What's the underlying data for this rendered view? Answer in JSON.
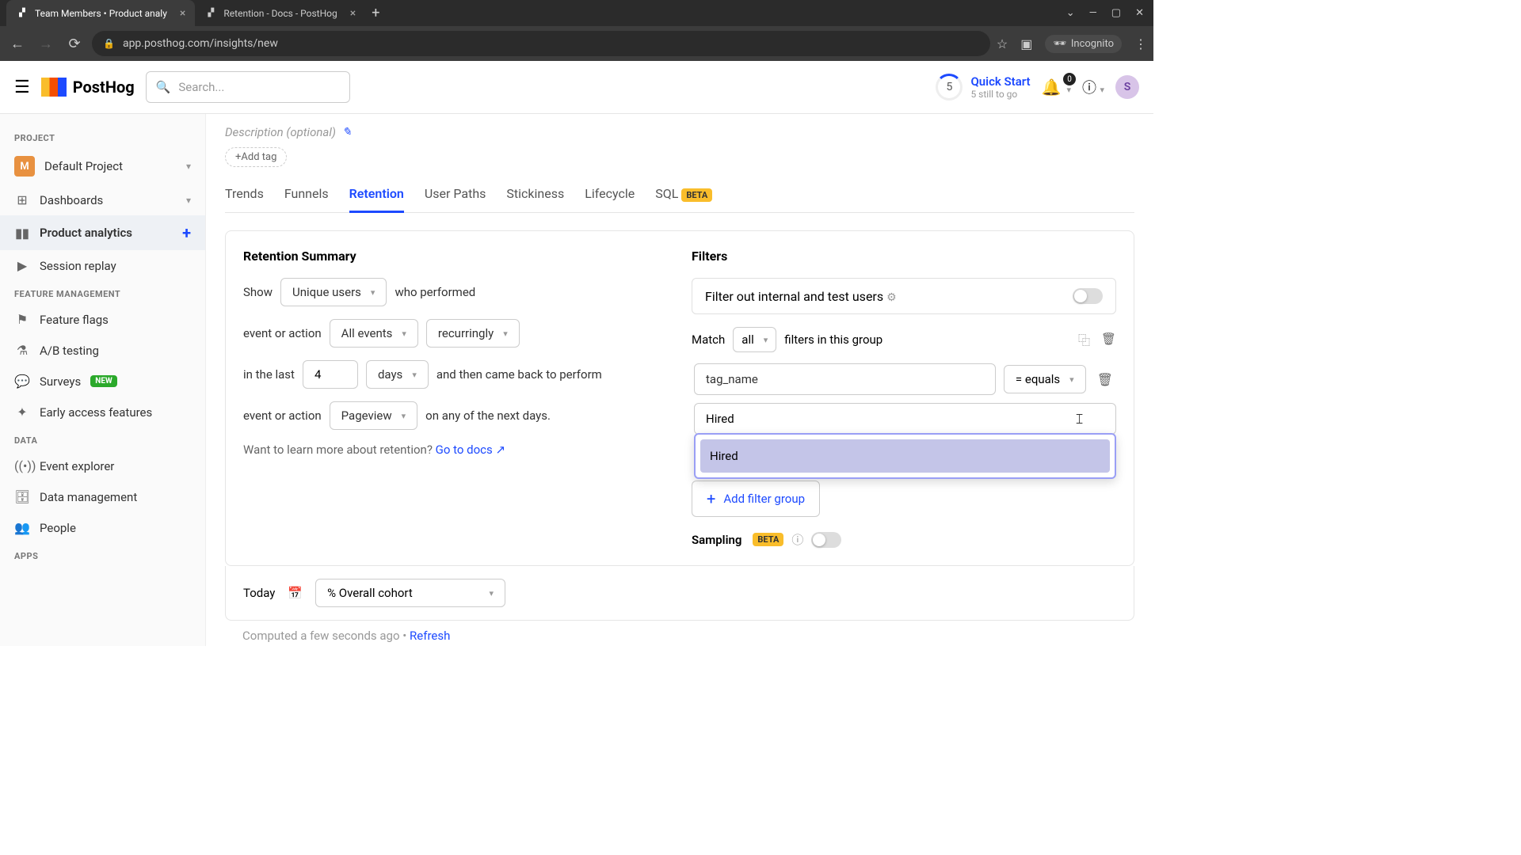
{
  "browser": {
    "tabs": [
      {
        "title": "Team Members • Product analy",
        "active": true
      },
      {
        "title": "Retention - Docs - PostHog",
        "active": false
      }
    ],
    "url": "app.posthog.com/insights/new",
    "incognito": "Incognito"
  },
  "header": {
    "logo": "PostHog",
    "search_placeholder": "Search...",
    "quick_start": {
      "count": "5",
      "title": "Quick Start",
      "sub": "5 still to go"
    },
    "bell_count": "0",
    "avatar_letter": "S"
  },
  "sidebar": {
    "sections": {
      "project": "PROJECT",
      "feature_mgmt": "FEATURE MANAGEMENT",
      "data": "DATA",
      "apps": "APPS"
    },
    "project": {
      "avatar": "M",
      "name": "Default Project"
    },
    "items": {
      "dashboards": "Dashboards",
      "product_analytics": "Product analytics",
      "session_replay": "Session replay",
      "feature_flags": "Feature flags",
      "ab_testing": "A/B testing",
      "surveys": "Surveys",
      "early_access": "Early access features",
      "event_explorer": "Event explorer",
      "data_mgmt": "Data management",
      "people": "People"
    },
    "new_badge": "NEW"
  },
  "main": {
    "description_placeholder": "Description (optional)",
    "add_tag": "Add tag",
    "tabs": [
      "Trends",
      "Funnels",
      "Retention",
      "User Paths",
      "Stickiness",
      "Lifecycle",
      "SQL"
    ],
    "active_tab": "Retention",
    "beta_label": "BETA",
    "retention": {
      "title": "Retention Summary",
      "show": "Show",
      "unique_users": "Unique users",
      "who_performed": "who performed",
      "event_or_action": "event or action",
      "all_events": "All events",
      "recurringly": "recurringly",
      "in_the_last": "in the last",
      "count": "4",
      "days": "days",
      "came_back": "and then came back to perform",
      "pageview": "Pageview",
      "next_days": "on any of the next days.",
      "learn_text": "Want to learn more about retention? ",
      "learn_link": "Go to docs"
    },
    "filters": {
      "title": "Filters",
      "filter_out": "Filter out internal and test users",
      "match": "Match",
      "all": "all",
      "filters_in_group": "filters in this group",
      "prop": "tag_name",
      "equals": "= equals",
      "value": "Hired",
      "autocomplete": "Hired",
      "add_filter": "Add filter group",
      "sampling": "Sampling"
    },
    "bottom": {
      "today": "Today",
      "cohort": "% Overall cohort",
      "computed": "Computed a few seconds ago • ",
      "refresh": "Refresh"
    }
  }
}
